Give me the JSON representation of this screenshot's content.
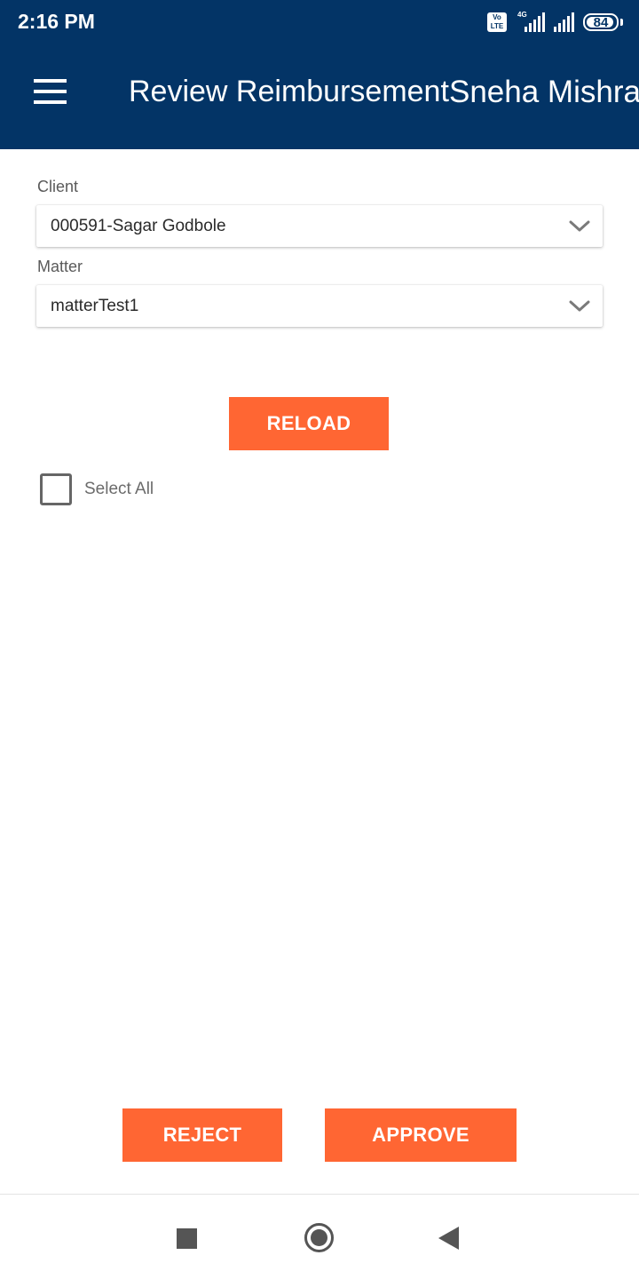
{
  "status_bar": {
    "time": "2:16 PM",
    "volte_line1": "Vo",
    "volte_line2": "LTE",
    "network_type": "4G",
    "battery_level": "84",
    "icons": [
      "volte-icon",
      "signal-icon",
      "signal-icon",
      "battery-icon"
    ]
  },
  "header": {
    "title": "Review Reimbursement",
    "user_name": "Sneha Mishra",
    "menu_icon": "hamburger-menu-icon"
  },
  "form": {
    "client_label": "Client",
    "client_value": "000591-Sagar Godbole",
    "matter_label": "Matter",
    "matter_value": "matterTest1",
    "dropdown_icon": "chevron-down-icon"
  },
  "actions": {
    "reload_label": "RELOAD",
    "select_all_label": "Select All",
    "select_all_checked": false,
    "reject_label": "REJECT",
    "approve_label": "APPROVE"
  },
  "nav": {
    "icons": [
      "recents-square-icon",
      "home-circle-icon",
      "back-triangle-icon"
    ]
  },
  "colors": {
    "header_bg": "#033466",
    "accent": "#ff6633",
    "text_white": "#ffffff"
  }
}
